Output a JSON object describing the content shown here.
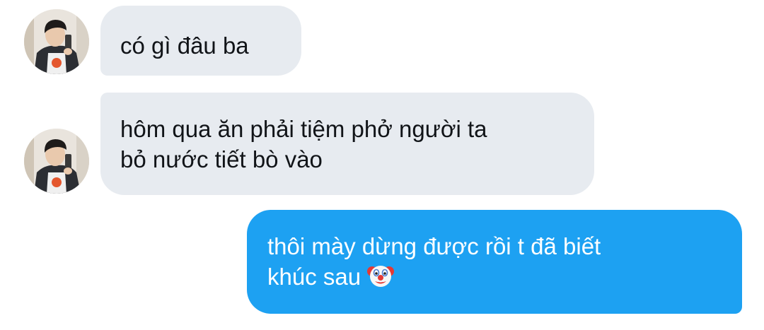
{
  "messages": [
    {
      "side": "incoming",
      "text": "có gì đâu ba",
      "avatar": "user-avatar"
    },
    {
      "side": "incoming",
      "text": "hôm qua ăn phải tiệm phở người ta\nbỏ nước tiết bò vào",
      "avatar": "user-avatar"
    },
    {
      "side": "outgoing",
      "text": "thôi mày dừng được rồi t đã biết\nkhúc sau",
      "emoji": "clown-face-icon"
    }
  ],
  "colors": {
    "incoming_bubble": "#e7ebf0",
    "outgoing_bubble": "#1da1f2",
    "incoming_text": "#111418",
    "outgoing_text": "#ffffff"
  }
}
